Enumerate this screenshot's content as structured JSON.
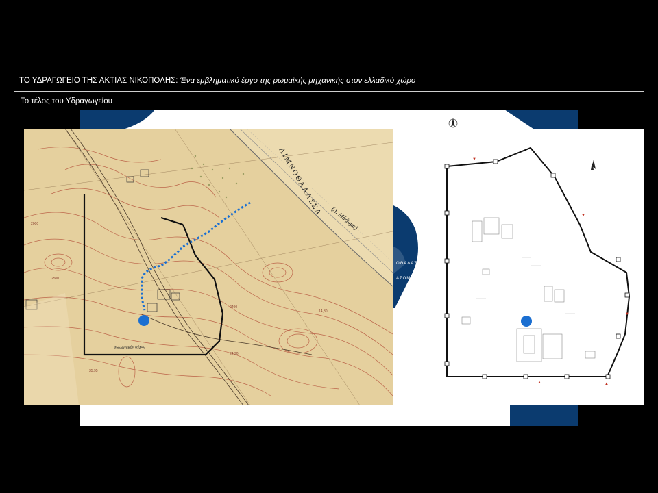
{
  "header": {
    "title_main": "ΤΟ ΥΔΡΑΓΩΓΕΙΟ ΤΗΣ ΑΚΤΙΑΣ ΝΙΚΟΠΟΛΗΣ:",
    "title_italic": "Ένα εμβληματικό έργο της ρωμαϊκής μηχανικής στον ελλαδικό χώρο",
    "subtitle": "Το τέλος του Υδραγωγείου"
  },
  "background_map": {
    "label_lagoon": "ΟΘΑΛΑΣΣΑ",
    "label_lagoon_en": "AZOMA LAG"
  },
  "left_map": {
    "label_limnothalassa": "ΛΙΜΝΟΘΑΛΑΣΣΑ",
    "label_mazoma": "(Λ. Μάζωμα)",
    "label_wall": "Εσωτερικόν τείχος",
    "colors": {
      "paper": "#e9d4a3",
      "contour": "#b5533c",
      "marker": "#1b6fd1"
    }
  },
  "right_map": {
    "colors": {
      "wall": "#111111",
      "marker": "#1b6fd1",
      "accent": "#c03020"
    }
  },
  "colors": {
    "background": "#000000",
    "navy": "#0b3b6f"
  }
}
